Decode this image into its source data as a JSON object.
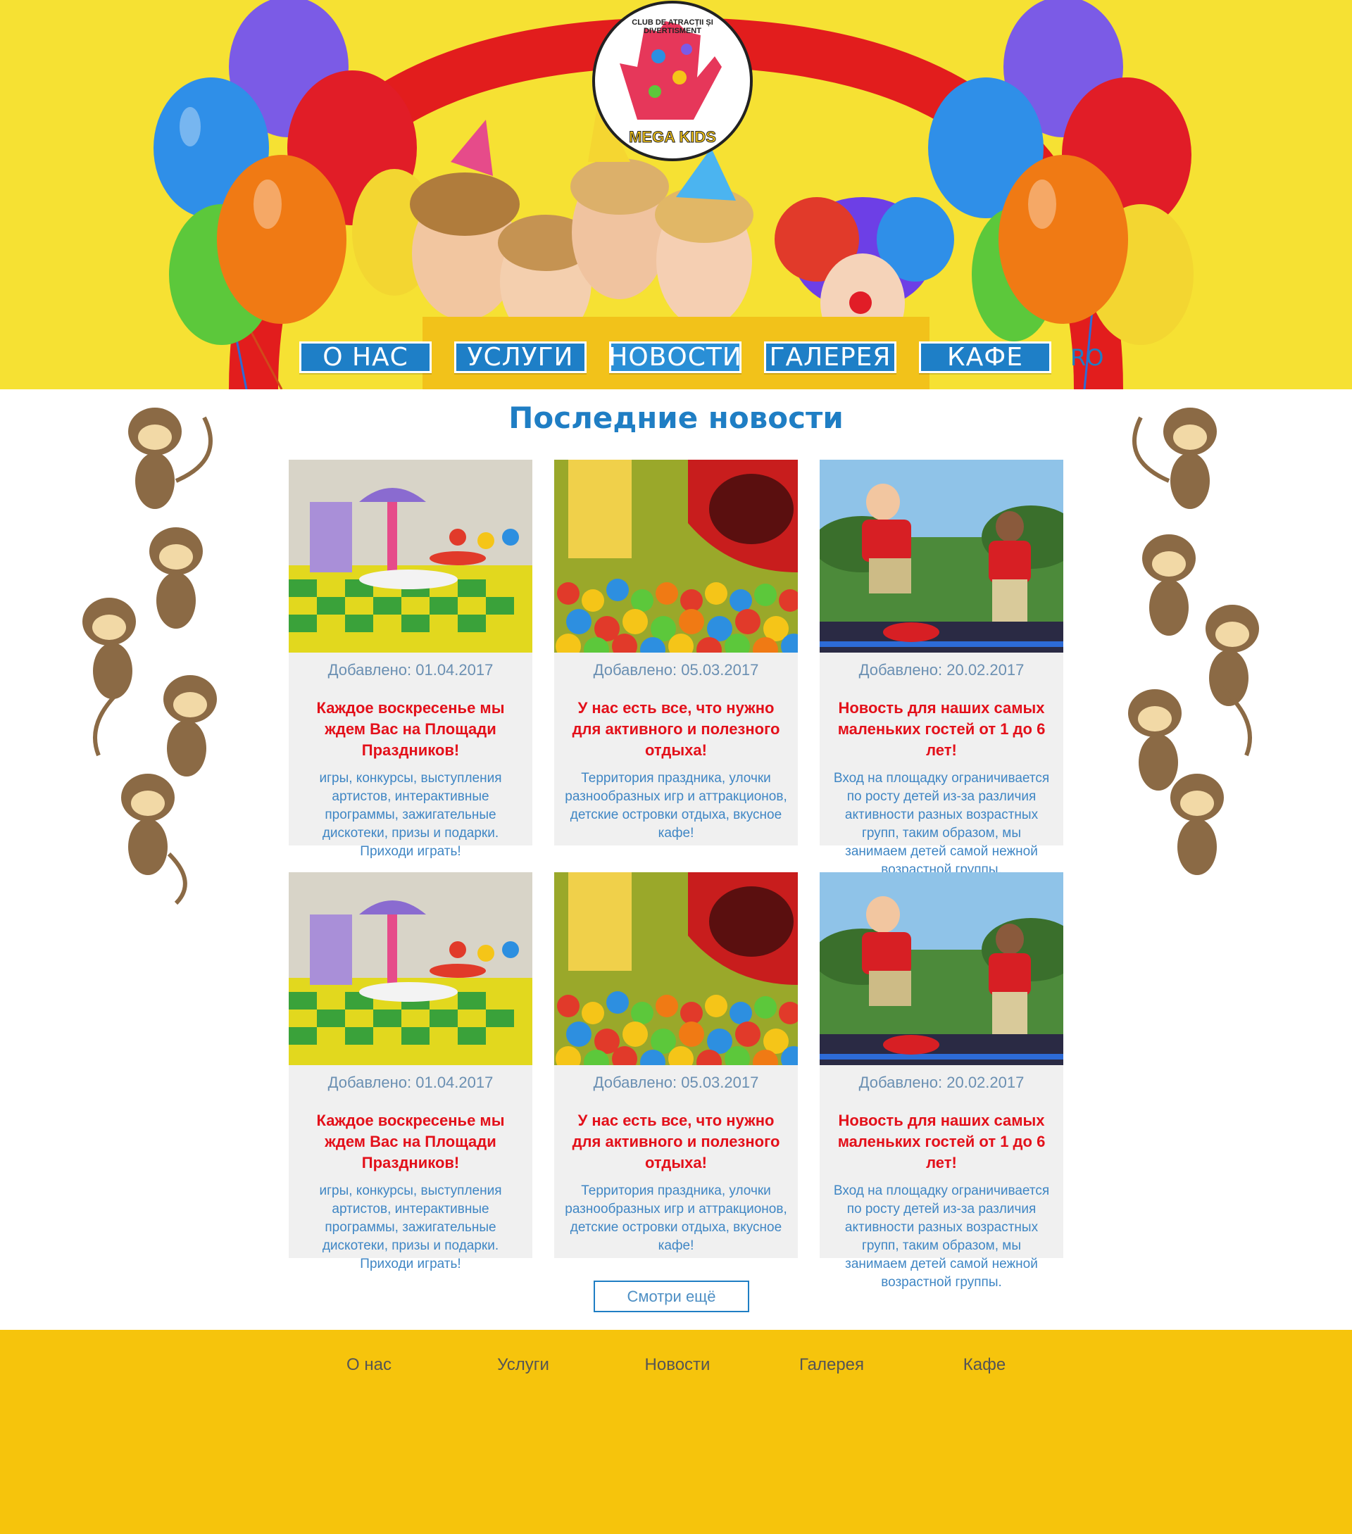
{
  "header": {
    "logo": {
      "arc_text": "CLUB DE ATRACȚII ȘI DIVERTISMENT",
      "name": "MEGA KIDS"
    },
    "nav": [
      {
        "label": "О НАС"
      },
      {
        "label": "УСЛУГИ"
      },
      {
        "label": "НОВОСТИ",
        "active": true
      },
      {
        "label": "ГАЛЕРЕЯ"
      },
      {
        "label": "КАФЕ"
      }
    ],
    "language": "RO"
  },
  "main": {
    "title": "Последние новости",
    "cards": [
      {
        "image": "playroom-photo",
        "date": "Добавлено: 01.04.2017",
        "headline": "Каждое воскресенье мы ждем Вас на Площади Праздников!",
        "text": "игры, конкурсы, выступления артистов, интерактивные программы, зажигательные дискотеки, призы и подарки. Приходи играть!"
      },
      {
        "image": "ball-pit-photo",
        "date": "Добавлено: 05.03.2017",
        "headline": "У нас есть все, что нужно для активного и полезного отдыха!",
        "text": "Территория праздника, улочки разнообразных игр и аттракционов, детские островки отдыха, вкусное кафе!"
      },
      {
        "image": "trampoline-photo",
        "date": "Добавлено: 20.02.2017",
        "headline": "Новость для наших самых маленьких гостей от 1 до 6 лет!",
        "text": "Вход на площадку ограничивается по росту детей из-за различия активности разных возрастных групп, таким образом, мы занимаем детей самой нежной возрастной группы."
      },
      {
        "image": "playroom-photo",
        "date": "Добавлено: 01.04.2017",
        "headline": "Каждое воскресенье мы ждем Вас на Площади Праздников!",
        "text": "игры, конкурсы, выступления артистов, интерактивные программы, зажигательные дискотеки, призы и подарки. Приходи играть!"
      },
      {
        "image": "ball-pit-photo",
        "date": "Добавлено: 05.03.2017",
        "headline": "У нас есть все, что нужно для активного и полезного отдыха!",
        "text": "Территория праздника, улочки разнообразных игр и аттракционов, детские островки отдыха, вкусное кафе!"
      },
      {
        "image": "trampoline-photo",
        "date": "Добавлено: 20.02.2017",
        "headline": "Новость для наших самых маленьких гостей от 1 до 6 лет!",
        "text": "Вход на площадку ограничивается по росту детей из-за различия активности разных возрастных групп, таким образом, мы занимаем детей самой нежной возрастной группы."
      }
    ],
    "more_button": "Смотри ещё"
  },
  "footer": {
    "links": [
      "О нас",
      "Услуги",
      "Новости",
      "Галерея",
      "Кафе"
    ]
  },
  "colors": {
    "header_yellow": "#f6e133",
    "nav_blue": "#1e7fc7",
    "title_blue": "#1f7ec4",
    "headline_red": "#e3101a",
    "card_gray": "#f0f0f0",
    "footer_yellow": "#f6c40c"
  }
}
